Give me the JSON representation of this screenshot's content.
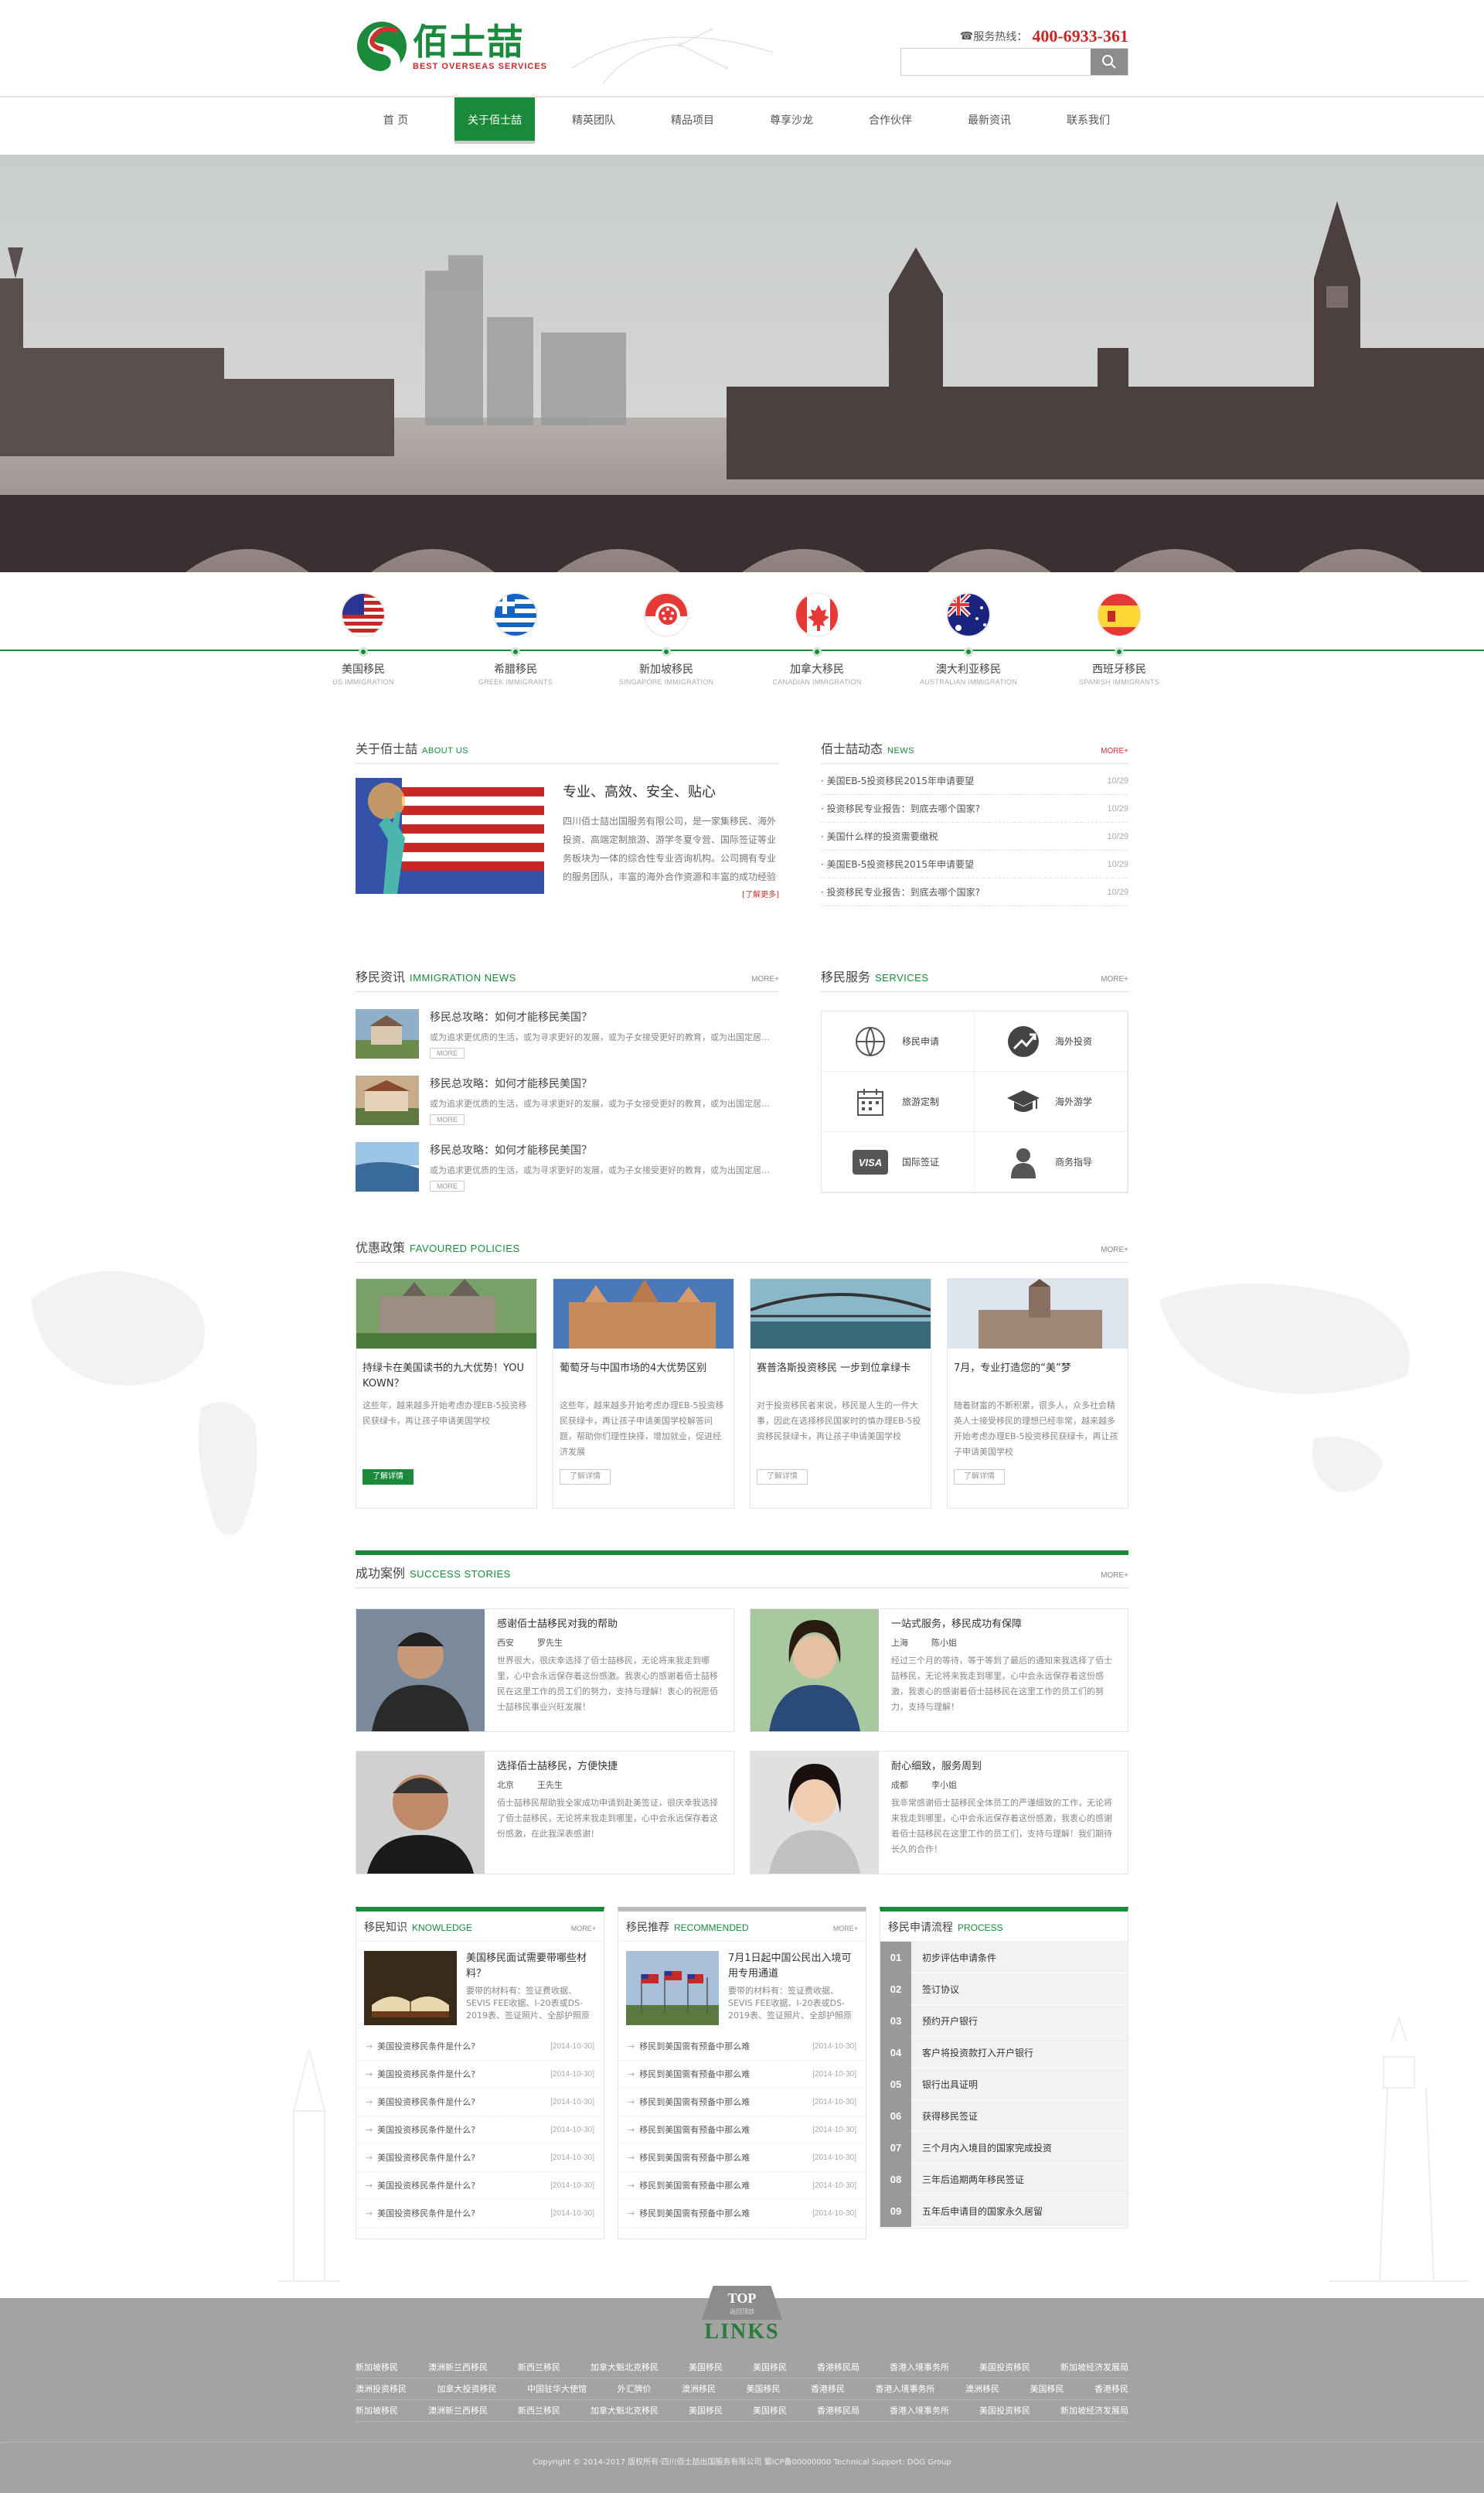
{
  "header": {
    "logo_cn": "佰士喆",
    "logo_en": "BEST OVERSEAS SERVICES",
    "hotline_label": "服务热线：",
    "hotline_number": "400-6933-361",
    "search_placeholder": ""
  },
  "nav": [
    "首 页",
    "关于佰士喆",
    "精英团队",
    "精品项目",
    "尊享沙龙",
    "合作伙伴",
    "最新资讯",
    "联系我们"
  ],
  "countries": [
    {
      "cn": "美国移民",
      "en": "US IMMIGRATION"
    },
    {
      "cn": "希腊移民",
      "en": "GREEK IMMIGRANTS"
    },
    {
      "cn": "新加坡移民",
      "en": "SINGAPORE IMMIGRATION"
    },
    {
      "cn": "加拿大移民",
      "en": "CANADIAN IMMIGRATION"
    },
    {
      "cn": "澳大利亚移民",
      "en": "AUSTRALIAN IMMIGRATION"
    },
    {
      "cn": "西班牙移民",
      "en": "SPANISH IMMIGRANTS"
    }
  ],
  "about": {
    "title": "关于佰士喆",
    "title_en": "ABOUT US",
    "heading": "专业、高效、安全、贴心",
    "desc": "四川佰士喆出国服务有限公司，是一家集移民、海外投资、高端定制旅游、游学冬夏令营、国际签证等业务板块为一体的综合性专业咨询机构。公司拥有专业的服务团队，丰富的海外合作资源和丰富的成功经验",
    "more": "[了解更多]"
  },
  "news": {
    "title": "佰士喆动态",
    "title_en": "NEWS",
    "more": "MORE+",
    "items": [
      {
        "text": "· 美国EB-5投资移民2015年申请要望",
        "date": "10/29"
      },
      {
        "text": "· 投资移民专业报告：到底去哪个国家?",
        "date": "10/29"
      },
      {
        "text": "· 美国什么样的投资需要缴税",
        "date": "10/29"
      },
      {
        "text": "· 美国EB-5投资移民2015年申请要望",
        "date": "10/29"
      },
      {
        "text": "· 投资移民专业报告：到底去哪个国家?",
        "date": "10/29"
      }
    ]
  },
  "immnews": {
    "title": "移民资讯",
    "title_en": "IMMIGRATION NEWS",
    "more": "MORE+",
    "items": [
      {
        "title": "移民总攻略：如何才能移民美国？",
        "desc": "或为追求更优质的生活，或为寻求更好的发展，或为子女接受更好的教育，或为出国定居，越来越多的人选择移民",
        "more": "MORE"
      },
      {
        "title": "移民总攻略：如何才能移民美国？",
        "desc": "或为追求更优质的生活，或为寻求更好的发展，或为子女接受更好的教育，或为出国定居，越来越多的人选择移民",
        "more": "MORE"
      },
      {
        "title": "移民总攻略：如何才能移民美国？",
        "desc": "或为追求更优质的生活，或为寻求更好的发展，或为子女接受更好的教育，或为出国定居，越来越多的人选择移民",
        "more": "MORE"
      }
    ]
  },
  "services": {
    "title": "移民服务",
    "title_en": "SERVICES",
    "more": "MORE+",
    "items": [
      {
        "label": "移民申请",
        "icon": "globe-icon"
      },
      {
        "label": "海外投资",
        "icon": "chart-icon"
      },
      {
        "label": "旅游定制",
        "icon": "calendar-icon"
      },
      {
        "label": "海外游学",
        "icon": "graduation-cap-icon"
      },
      {
        "label": "国际签证",
        "icon": "visa-icon"
      },
      {
        "label": "商务指导",
        "icon": "person-icon"
      }
    ]
  },
  "policies": {
    "title": "优惠政策",
    "title_en": "FAVOURED POLICIES",
    "more": "MORE+",
    "items": [
      {
        "title": "持绿卡在美国读书的九大优势！YOU KOWN？",
        "desc": "这些年，越来越多开始考虑办理EB-5投资移民获绿卡，再让孩子申请美国学校",
        "btn": "了解详情"
      },
      {
        "title": "葡萄牙与中国市场的4大优势区别",
        "desc": "这些年，越来越多开始考虑办理EB-5投资移民获绿卡，再让孩子申请美国学校解答问题，帮助你们理性抉择，增加就业，促进经济发展",
        "btn": "了解详情"
      },
      {
        "title": "赛普洛斯投资移民 一步到位拿绿卡",
        "desc": "对于投资移民者来说，移民是人生的一件大事，因此在选择移民国家时的慎办理EB-5投资移民获绿卡，再让孩子申请美国学校",
        "btn": "了解详情"
      },
      {
        "title": "7月，专业打造您的“美”梦",
        "desc": "随着财富的不断积累，很多人，众多社会精英人士接受移民的理想已经非常，越来越多开始考虑办理EB-5投资移民获绿卡，再让孩子申请美国学校",
        "btn": "了解详情"
      }
    ]
  },
  "success": {
    "title": "成功案例",
    "title_en": "SUCCESS STORIES",
    "more": "MORE+",
    "items": [
      {
        "title": "感谢佰士喆移民对我的帮助",
        "city": "西安",
        "name": "罗先生",
        "desc": "世界很大，很庆幸选择了佰士喆移民，无论将来我走到哪里，心中会永远保存着这份感激。我衷心的感谢着佰士喆移民在这里工作的员工们的努力，支持与理解！衷心的祝愿佰士喆移民事业兴旺发展！"
      },
      {
        "title": "一站式服务，移民成功有保障",
        "city": "上海",
        "name": "陈小姐",
        "desc": "经过三个月的等待，等于等到了最后的通知来我选择了佰士喆移民，无论将来我走到哪里，心中会永远保存着这份感激，我衷心的感谢着佰士喆移民在这里工作的员工们的努力，支持与理解！"
      },
      {
        "title": "选择佰士喆移民，方便快捷",
        "city": "北京",
        "name": "王先生",
        "desc": "佰士喆移民帮助我全家成功申请到赴美签证，很庆幸我选择了佰士喆移民，无论将来我走到哪里，心中会永远保存着这份感激，在此我深表感谢！"
      },
      {
        "title": "耐心细致，服务周到",
        "city": "成都",
        "name": "李小姐",
        "desc": "我非常感谢佰士喆移民全体员工的严谨细致的工作，无论将来我走到哪里，心中会永远保存着这份感激，我衷心的感谢着佰士喆移民在这里工作的员工们，支持与理解！我们期待长久的合作！"
      }
    ]
  },
  "knowledge": {
    "title": "移民知识",
    "title_en": "KNOWLEDGE",
    "more": "MORE+",
    "feat_title": "美国移民面试需要带哪些材料？",
    "feat_desc": "要带的材料有：签证费收据、SEVIS FEE收据、I-20表或DS-2019表、签证照片、全部护照原件...",
    "items": [
      {
        "text": "美国投资移民条件是什么?",
        "date": "[2014-10-30]"
      },
      {
        "text": "美国投资移民条件是什么?",
        "date": "[2014-10-30]"
      },
      {
        "text": "美国投资移民条件是什么?",
        "date": "[2014-10-30]"
      },
      {
        "text": "美国投资移民条件是什么?",
        "date": "[2014-10-30]"
      },
      {
        "text": "美国投资移民条件是什么?",
        "date": "[2014-10-30]"
      },
      {
        "text": "美国投资移民条件是什么?",
        "date": "[2014-10-30]"
      },
      {
        "text": "美国投资移民条件是什么?",
        "date": "[2014-10-30]"
      }
    ]
  },
  "recommended": {
    "title": "移民推荐",
    "title_en": "RECOMMENDED",
    "more": "MORE+",
    "feat_title": "7月1日起中国公民出入境可用专用通道",
    "feat_desc": "要带的材料有：签证费收据、SEVIS FEE收据、I-20表或DS-2019表、签证照片、全部护照原件...",
    "items": [
      {
        "text": "移民到美国需有预备中那么难",
        "date": "[2014-10-30]"
      },
      {
        "text": "移民到美国需有预备中那么难",
        "date": "[2014-10-30]"
      },
      {
        "text": "移民到美国需有预备中那么难",
        "date": "[2014-10-30]"
      },
      {
        "text": "移民到美国需有预备中那么难",
        "date": "[2014-10-30]"
      },
      {
        "text": "移民到美国需有预备中那么难",
        "date": "[2014-10-30]"
      },
      {
        "text": "移民到美国需有预备中那么难",
        "date": "[2014-10-30]"
      },
      {
        "text": "移民到美国需有预备中那么难",
        "date": "[2014-10-30]"
      }
    ]
  },
  "process": {
    "title": "移民申请流程",
    "title_en": "PROCESS",
    "steps": [
      {
        "num": "01",
        "text": "初步评估申请条件"
      },
      {
        "num": "02",
        "text": "签订协议"
      },
      {
        "num": "03",
        "text": "预约开户银行"
      },
      {
        "num": "04",
        "text": "客户将投资款打入开户银行"
      },
      {
        "num": "05",
        "text": "银行出具证明"
      },
      {
        "num": "06",
        "text": "获得移民签证"
      },
      {
        "num": "07",
        "text": "三个月内入境目的国家完成投资"
      },
      {
        "num": "08",
        "text": "三年后追期两年移民签证"
      },
      {
        "num": "09",
        "text": "五年后申请目的国家永久居留"
      }
    ]
  },
  "footer": {
    "top_label": "TOP",
    "top_sub": "返回顶部",
    "links_title": "LINKS",
    "link_rows": [
      [
        "新加坡移民",
        "澳洲新兰西移民",
        "新西兰移民",
        "加拿大魁北克移民",
        "美国移民",
        "美国移民",
        "香港移民局",
        "香港入境事务所",
        "美国投资移民",
        "新加坡经济发展局"
      ],
      [
        "澳洲投资移民",
        "加拿大投资移民",
        "中国驻华大使馆",
        "外汇牌价",
        "澳洲移民",
        "美国移民",
        "香港移民",
        "香港入境事务所",
        "澳洲移民",
        "美国移民",
        "香港移民"
      ],
      [
        "新加坡移民",
        "澳洲新兰西移民",
        "新西兰移民",
        "加拿大魁北克移民",
        "美国移民",
        "美国移民",
        "香港移民局",
        "香港入境事务所",
        "美国投资移民",
        "新加坡经济发展局"
      ]
    ],
    "copyright": "Copyright © 2014-2017 版权所有·四川佰士喆出国服务有限公司   蜀ICP备00000000  Technical Support: DOG Group"
  },
  "colors": {
    "brand_green": "#1a8a3a",
    "accent_red": "#c62828"
  }
}
